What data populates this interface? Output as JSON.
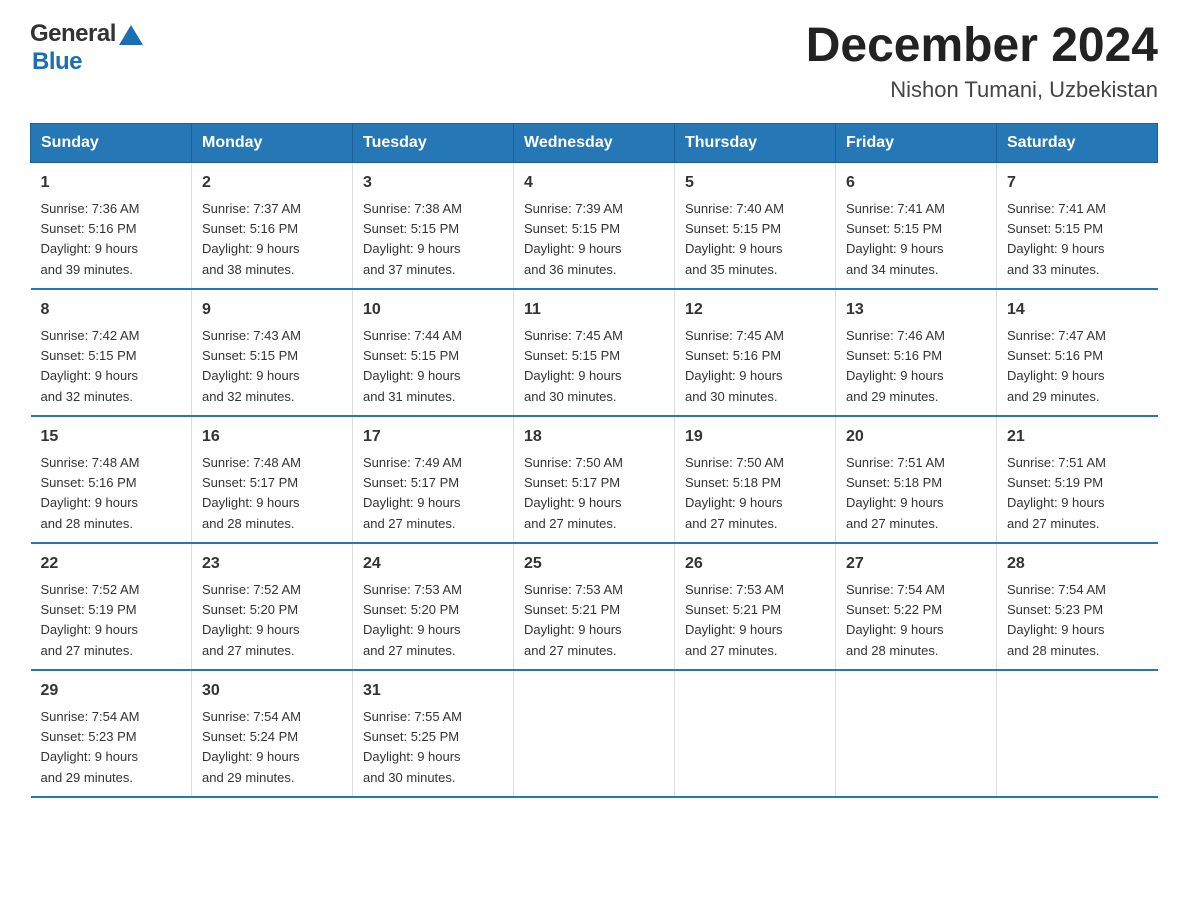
{
  "header": {
    "title": "December 2024",
    "subtitle": "Nishon Tumani, Uzbekistan",
    "logo_general": "General",
    "logo_blue": "Blue"
  },
  "calendar": {
    "days_of_week": [
      "Sunday",
      "Monday",
      "Tuesday",
      "Wednesday",
      "Thursday",
      "Friday",
      "Saturday"
    ],
    "weeks": [
      [
        {
          "day": "1",
          "sunrise": "7:36 AM",
          "sunset": "5:16 PM",
          "daylight": "9 hours and 39 minutes."
        },
        {
          "day": "2",
          "sunrise": "7:37 AM",
          "sunset": "5:16 PM",
          "daylight": "9 hours and 38 minutes."
        },
        {
          "day": "3",
          "sunrise": "7:38 AM",
          "sunset": "5:15 PM",
          "daylight": "9 hours and 37 minutes."
        },
        {
          "day": "4",
          "sunrise": "7:39 AM",
          "sunset": "5:15 PM",
          "daylight": "9 hours and 36 minutes."
        },
        {
          "day": "5",
          "sunrise": "7:40 AM",
          "sunset": "5:15 PM",
          "daylight": "9 hours and 35 minutes."
        },
        {
          "day": "6",
          "sunrise": "7:41 AM",
          "sunset": "5:15 PM",
          "daylight": "9 hours and 34 minutes."
        },
        {
          "day": "7",
          "sunrise": "7:41 AM",
          "sunset": "5:15 PM",
          "daylight": "9 hours and 33 minutes."
        }
      ],
      [
        {
          "day": "8",
          "sunrise": "7:42 AM",
          "sunset": "5:15 PM",
          "daylight": "9 hours and 32 minutes."
        },
        {
          "day": "9",
          "sunrise": "7:43 AM",
          "sunset": "5:15 PM",
          "daylight": "9 hours and 32 minutes."
        },
        {
          "day": "10",
          "sunrise": "7:44 AM",
          "sunset": "5:15 PM",
          "daylight": "9 hours and 31 minutes."
        },
        {
          "day": "11",
          "sunrise": "7:45 AM",
          "sunset": "5:15 PM",
          "daylight": "9 hours and 30 minutes."
        },
        {
          "day": "12",
          "sunrise": "7:45 AM",
          "sunset": "5:16 PM",
          "daylight": "9 hours and 30 minutes."
        },
        {
          "day": "13",
          "sunrise": "7:46 AM",
          "sunset": "5:16 PM",
          "daylight": "9 hours and 29 minutes."
        },
        {
          "day": "14",
          "sunrise": "7:47 AM",
          "sunset": "5:16 PM",
          "daylight": "9 hours and 29 minutes."
        }
      ],
      [
        {
          "day": "15",
          "sunrise": "7:48 AM",
          "sunset": "5:16 PM",
          "daylight": "9 hours and 28 minutes."
        },
        {
          "day": "16",
          "sunrise": "7:48 AM",
          "sunset": "5:17 PM",
          "daylight": "9 hours and 28 minutes."
        },
        {
          "day": "17",
          "sunrise": "7:49 AM",
          "sunset": "5:17 PM",
          "daylight": "9 hours and 27 minutes."
        },
        {
          "day": "18",
          "sunrise": "7:50 AM",
          "sunset": "5:17 PM",
          "daylight": "9 hours and 27 minutes."
        },
        {
          "day": "19",
          "sunrise": "7:50 AM",
          "sunset": "5:18 PM",
          "daylight": "9 hours and 27 minutes."
        },
        {
          "day": "20",
          "sunrise": "7:51 AM",
          "sunset": "5:18 PM",
          "daylight": "9 hours and 27 minutes."
        },
        {
          "day": "21",
          "sunrise": "7:51 AM",
          "sunset": "5:19 PM",
          "daylight": "9 hours and 27 minutes."
        }
      ],
      [
        {
          "day": "22",
          "sunrise": "7:52 AM",
          "sunset": "5:19 PM",
          "daylight": "9 hours and 27 minutes."
        },
        {
          "day": "23",
          "sunrise": "7:52 AM",
          "sunset": "5:20 PM",
          "daylight": "9 hours and 27 minutes."
        },
        {
          "day": "24",
          "sunrise": "7:53 AM",
          "sunset": "5:20 PM",
          "daylight": "9 hours and 27 minutes."
        },
        {
          "day": "25",
          "sunrise": "7:53 AM",
          "sunset": "5:21 PM",
          "daylight": "9 hours and 27 minutes."
        },
        {
          "day": "26",
          "sunrise": "7:53 AM",
          "sunset": "5:21 PM",
          "daylight": "9 hours and 27 minutes."
        },
        {
          "day": "27",
          "sunrise": "7:54 AM",
          "sunset": "5:22 PM",
          "daylight": "9 hours and 28 minutes."
        },
        {
          "day": "28",
          "sunrise": "7:54 AM",
          "sunset": "5:23 PM",
          "daylight": "9 hours and 28 minutes."
        }
      ],
      [
        {
          "day": "29",
          "sunrise": "7:54 AM",
          "sunset": "5:23 PM",
          "daylight": "9 hours and 29 minutes."
        },
        {
          "day": "30",
          "sunrise": "7:54 AM",
          "sunset": "5:24 PM",
          "daylight": "9 hours and 29 minutes."
        },
        {
          "day": "31",
          "sunrise": "7:55 AM",
          "sunset": "5:25 PM",
          "daylight": "9 hours and 30 minutes."
        },
        null,
        null,
        null,
        null
      ]
    ]
  }
}
